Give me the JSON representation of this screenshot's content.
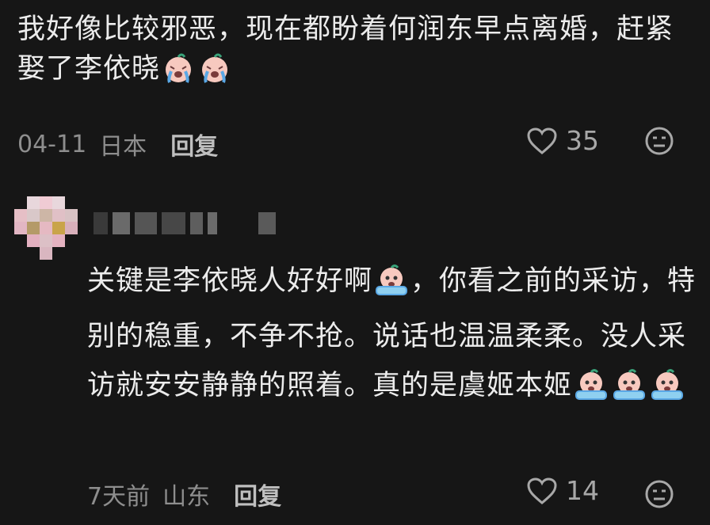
{
  "comments": [
    {
      "text_a": "我好像比较邪恶，现在都盼着何润东早点离婚，赶紧娶了李依晓",
      "emoji_after": [
        "crying-face",
        "crying-face"
      ],
      "date": "04-11",
      "location": "日本",
      "reply_label": "回复",
      "likes": "35"
    },
    {
      "username": "",
      "text_a": "关键是李依晓人好好啊",
      "text_b": "，你看之前的采访，特别的稳重，不争不抢。说话也温温柔柔。没人采访就安安静静的照着。真的是虞姬本姬",
      "date": "7天前",
      "location": "山东",
      "reply_label": "回复",
      "likes": "14"
    }
  ],
  "colors": {
    "background": "#161616",
    "text": "#ececec",
    "meta": "#8e8e8e"
  },
  "icons": [
    "heart-icon",
    "dislike-face-icon",
    "crying-face-emoji",
    "tears-emoji"
  ]
}
